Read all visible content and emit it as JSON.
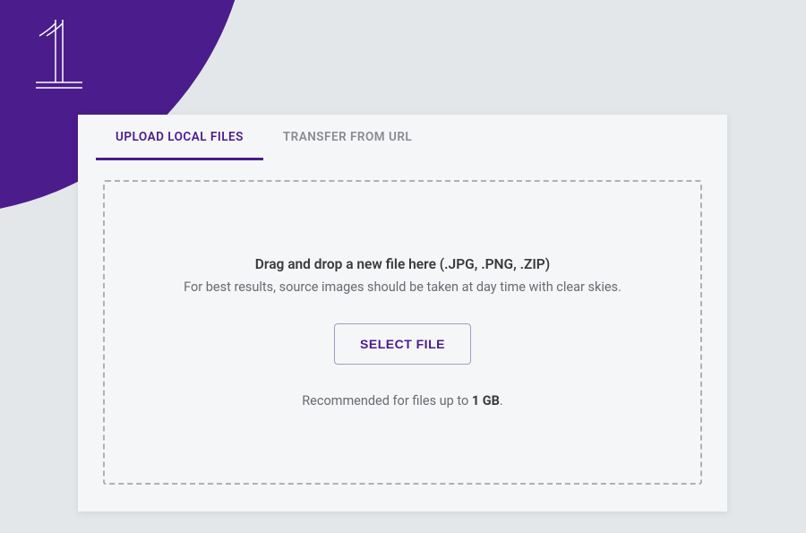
{
  "tabs": {
    "upload_local": "UPLOAD LOCAL FILES",
    "transfer_url": "TRANSFER FROM URL"
  },
  "dropzone": {
    "heading": "Drag and drop a new file here (.JPG, .PNG, .ZIP)",
    "subtext": "For best results, source images should be taken at day time with clear skies.",
    "button_label": "SELECT FILE",
    "footer_prefix": "Recommended for files up to ",
    "footer_limit": "1 GB",
    "footer_suffix": "."
  },
  "colors": {
    "brand": "#4a1c8c",
    "bg": "#e4e7ea",
    "card": "#f5f6f8"
  }
}
